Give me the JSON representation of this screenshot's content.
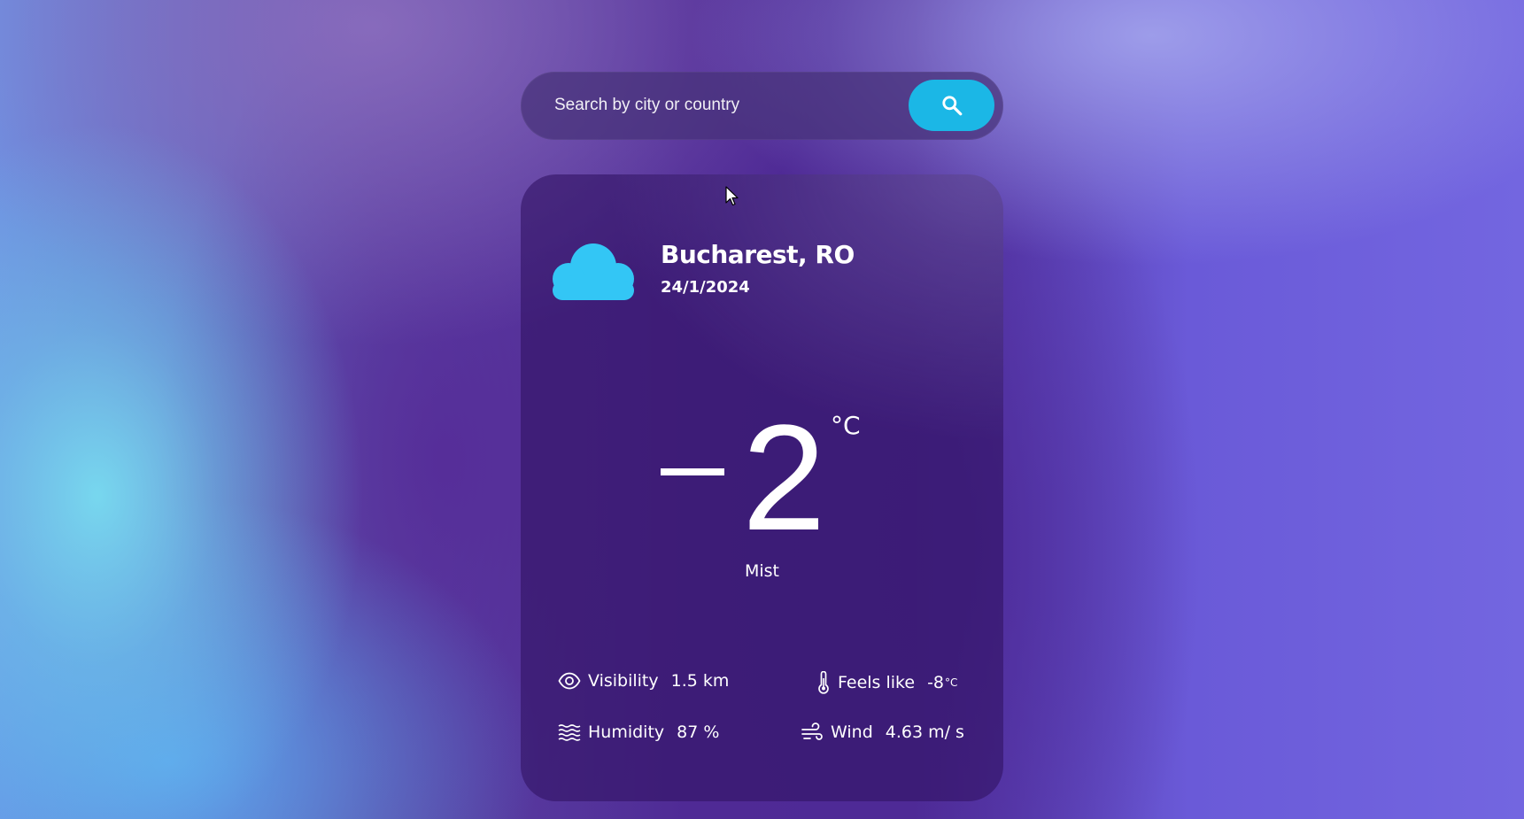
{
  "search": {
    "placeholder": "Search by city or country",
    "button_icon": "search-icon"
  },
  "location": {
    "city": "Bucharest, RO",
    "date": "24/1/2024",
    "weather_icon": "cloud-icon"
  },
  "temperature": {
    "sign": "−",
    "value": "2",
    "unit": "°C",
    "description": "Mist"
  },
  "details": {
    "visibility": {
      "label": "Visibility",
      "value": "1.5 km",
      "icon": "eye-icon"
    },
    "feels_like": {
      "label": "Feels like",
      "value": "-8",
      "unit": "°C",
      "icon": "thermometer-icon"
    },
    "humidity": {
      "label": "Humidity",
      "value": "87 %",
      "icon": "humidity-waves-icon"
    },
    "wind": {
      "label": "Wind",
      "value": "4.63 m/ s",
      "icon": "wind-icon"
    }
  },
  "colors": {
    "accent": "#1bb7e6",
    "cloud": "#33c6f5",
    "card_background": "#3a1e72"
  }
}
